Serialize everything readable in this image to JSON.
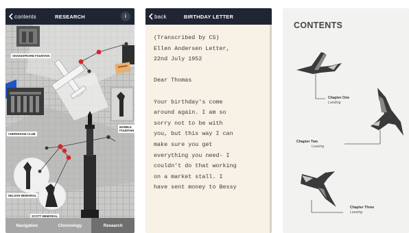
{
  "screens": [
    {
      "nav": {
        "back_label": "contents",
        "title": "RESEARCH",
        "badge": "i"
      },
      "map_labels": {
        "shakespeare": "SHAKESPEARE FOUNTAIN",
        "cherhouse": "CHERHOUSE CLUB",
        "marble": "MARBLE FOUNTAIN",
        "nelson": "NELSON MEMORIAL",
        "scott": "SCOTT MEMORIAL"
      },
      "tabs": [
        "Navigation",
        "Chronology",
        "Research"
      ],
      "active_tab": "Research"
    },
    {
      "nav": {
        "back_label": "back",
        "title": "BIRTHDAY LETTER"
      },
      "letter_lines": [
        "(Transcribed by CS)",
        "Ellen Andersen Letter,",
        "22nd July 1952",
        "",
        "Dear Thomas",
        "",
        "Your birthday's come",
        "around again. I am so",
        "sorry not to be with",
        "you, but this way I can",
        "make sure you get",
        "everything you need- I",
        "couldn't do that working",
        "on a market stall. I",
        "have sent money to Bessy"
      ]
    },
    {
      "title": "CONTENTS",
      "chapters": [
        {
          "title": "Chapter One",
          "subtitle": "Landing"
        },
        {
          "title": "Chapter Two",
          "subtitle": "Leaving"
        },
        {
          "title": "Chapter Three",
          "subtitle": "Leaving"
        }
      ]
    }
  ],
  "colors": {
    "navbar": "#1f2532",
    "map_bg": "#c9c9c7",
    "pin_red": "#d6262b",
    "tab_active": "#6f6f6f",
    "letter_bg": "#f7f1e6",
    "contents_bg": "#f2f2f0"
  }
}
